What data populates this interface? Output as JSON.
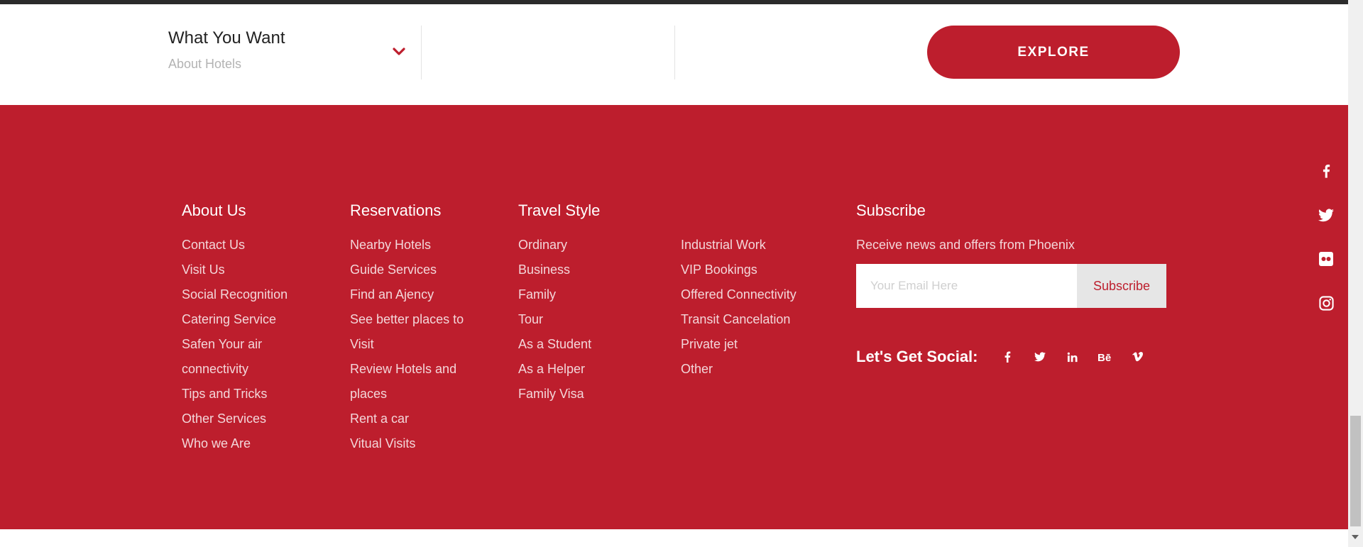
{
  "search": {
    "label": "What You Want",
    "sub": "About Hotels",
    "explore_label": "EXPLORE"
  },
  "footer": {
    "about": {
      "title": "About Us",
      "items": [
        "Contact Us",
        "Visit Us",
        "Social Recognition",
        "Catering Service",
        "Safen Your air",
        "connectivity",
        "Tips and Tricks",
        "Other Services",
        "Who we Are"
      ]
    },
    "reservations": {
      "title": "Reservations",
      "items": [
        "Nearby Hotels",
        "Guide Services",
        "Find an Ajency",
        "See better places to",
        "Visit",
        "Review Hotels and",
        "places",
        "Rent a car",
        "Vitual Visits"
      ]
    },
    "travel": {
      "title": "Travel Style",
      "items": [
        "Ordinary",
        "Business",
        "Family",
        "Tour",
        "As a Student",
        "As a Helper",
        "Family Visa"
      ]
    },
    "travel2": {
      "items": [
        "Industrial Work",
        "VIP Bookings",
        "Offered Connectivity",
        "Transit Cancelation",
        "Private jet",
        "Other"
      ]
    },
    "subscribe": {
      "title": "Subscribe",
      "text": "Receive news and offers from Phoenix",
      "placeholder": "Your Email Here",
      "button": "Subscribe",
      "social_label": "Let's Get Social:",
      "social_icons": [
        "facebook-icon",
        "twitter-icon",
        "linkedin-icon",
        "behance-icon",
        "vimeo-icon"
      ]
    }
  },
  "side_social": [
    "facebook-icon",
    "twitter-icon",
    "flickr-icon",
    "instagram-icon"
  ],
  "colors": {
    "brand_red": "#bd1e2d",
    "white": "#ffffff",
    "link_text": "#f3d6d9"
  }
}
